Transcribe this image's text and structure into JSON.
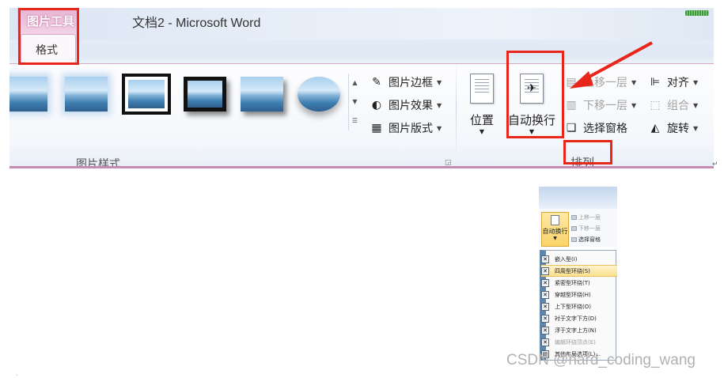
{
  "title_bar": {
    "context_group": "图片工具",
    "doc_title": "文档2 - Microsoft Word"
  },
  "tabs": [
    {
      "label": "格式",
      "selected": true
    }
  ],
  "ribbon": {
    "picture_styles": {
      "group_label": "图片样式",
      "commands": [
        {
          "label": "图片边框",
          "icon": "pencil-border-icon"
        },
        {
          "label": "图片效果",
          "icon": "effects-icon"
        },
        {
          "label": "图片版式",
          "icon": "layout-icon"
        }
      ]
    },
    "arrange": {
      "group_label": "排列",
      "position_label": "位置",
      "wrap_text_label": "自动换行",
      "bring_forward": "上移一层",
      "send_backward": "下移一层",
      "selection_pane": "选择窗格",
      "align": "对齐",
      "group": "组合",
      "rotate": "旋转"
    }
  },
  "dropdown": {
    "button_label": "自动换行",
    "side_commands": [
      "上移一层",
      "下移一层",
      "选择窗格"
    ],
    "items": [
      {
        "label": "嵌入型(I)",
        "highlighted": false,
        "disabled": false
      },
      {
        "label": "四周型环绕(S)",
        "highlighted": true,
        "disabled": false
      },
      {
        "label": "紧密型环绕(T)",
        "highlighted": false,
        "disabled": false
      },
      {
        "label": "穿越型环绕(H)",
        "highlighted": false,
        "disabled": false
      },
      {
        "label": "上下型环绕(O)",
        "highlighted": false,
        "disabled": false
      },
      {
        "label": "衬于文字下方(D)",
        "highlighted": false,
        "disabled": false
      },
      {
        "label": "浮于文字上方(N)",
        "highlighted": false,
        "disabled": false
      },
      {
        "label": "编辑环绕顶点(E)",
        "highlighted": false,
        "disabled": true
      },
      {
        "label": "其他布局选项(L)...",
        "highlighted": false,
        "disabled": false
      }
    ]
  },
  "watermark": "CSDN @hard_coding_wang",
  "colors": {
    "annotation_red": "#e8261c",
    "context_pink": "#c48bb3",
    "highlight": "#fbe08e"
  }
}
